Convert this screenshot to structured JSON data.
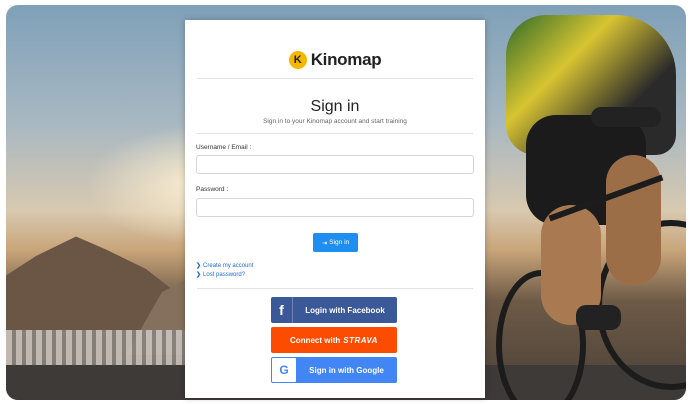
{
  "brand": {
    "logo_letter": "K",
    "name": "Kinomap"
  },
  "header": {
    "title": "Sign in",
    "subtitle": "Sign in to your Kinomap account and start training"
  },
  "form": {
    "username_label": "Username / Email :",
    "username_value": "",
    "password_label": "Password :",
    "password_value": "",
    "signin_icon": "⇥",
    "signin_label": "Sign in"
  },
  "links": {
    "create_account": "Create my account",
    "lost_password": "Lost password?"
  },
  "social": {
    "facebook_label": "Login with Facebook",
    "strava_prefix": "Connect with",
    "strava_brand": "STRAVA",
    "google_label": "Sign in with Google"
  },
  "colors": {
    "accent": "#1f8ef1",
    "facebook": "#3b5998",
    "strava": "#fc4c02",
    "google": "#4285f4",
    "logo": "#f5b800"
  },
  "icons": {
    "logo": "kinomap-logo-icon",
    "signin": "sign-in-arrow-icon",
    "facebook": "facebook-icon",
    "google": "google-icon",
    "chevron": "chevron-right-icon"
  }
}
